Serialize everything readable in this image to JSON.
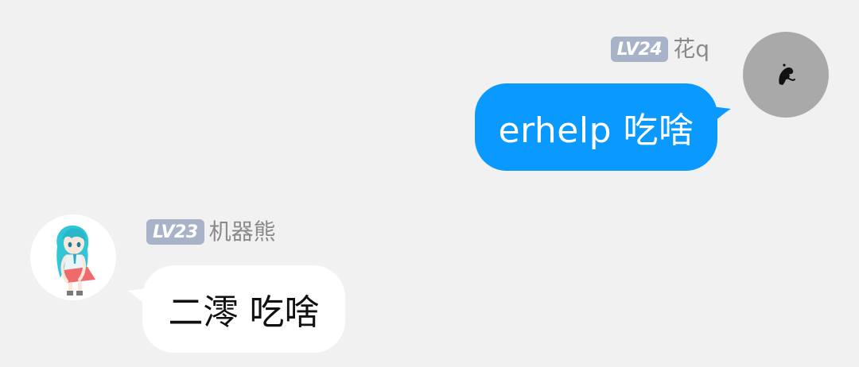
{
  "colors": {
    "background": "#f1f1f1",
    "outgoing_bubble": "#0a99ff",
    "incoming_bubble": "#ffffff",
    "level_badge": "#a8b2c8",
    "nickname": "#8a8a8a"
  },
  "messages": [
    {
      "direction": "outgoing",
      "level": "LV24",
      "sender": "花q",
      "text": "erhelp 吃啥",
      "avatar_icon": "black-silhouette-avatar-icon"
    },
    {
      "direction": "incoming",
      "level": "LV23",
      "sender": "机器熊",
      "text": "二澪 吃啥",
      "avatar_icon": "anime-girl-avatar-icon"
    }
  ]
}
